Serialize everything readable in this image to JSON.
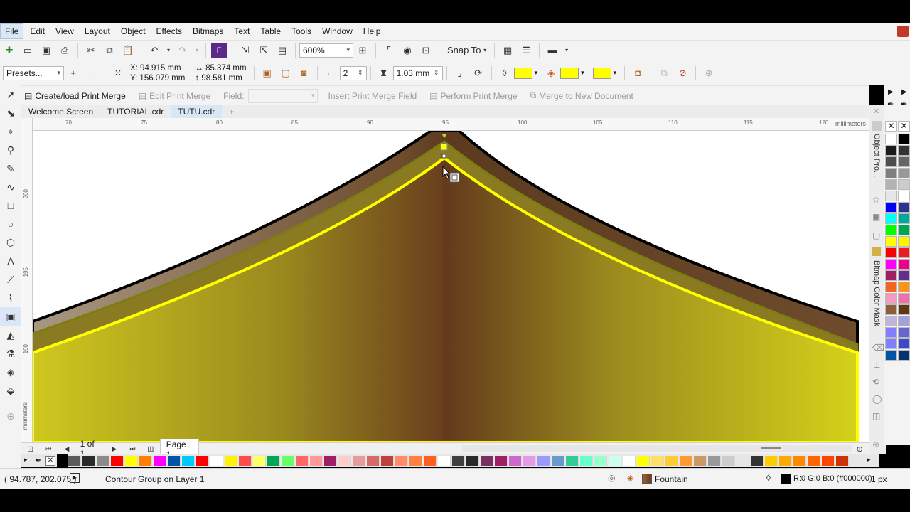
{
  "menu": [
    "File",
    "Edit",
    "View",
    "Layout",
    "Object",
    "Effects",
    "Bitmaps",
    "Text",
    "Table",
    "Tools",
    "Window",
    "Help"
  ],
  "toolbar1": {
    "zoom": "600%",
    "snap_to": "Snap To"
  },
  "propbar": {
    "presets": "Presets...",
    "x": "X: 94.915 mm",
    "y": "Y: 156.079 mm",
    "w": "85.374 mm",
    "h": "98.581 mm",
    "steps": "2",
    "offset": "1.03 mm",
    "colors": {
      "outline": "#ffff00",
      "fill": "#ffff00",
      "accel": "#ffff00"
    }
  },
  "printmerge": {
    "create": "Create/load Print Merge",
    "edit": "Edit Print Merge",
    "field": "Field:",
    "insert": "Insert Print Merge Field",
    "perform": "Perform Print Merge",
    "merge_new": "Merge to New Document"
  },
  "tabs": [
    "Welcome Screen",
    "TUTORIAL.cdr",
    "TUTU.cdr"
  ],
  "ruler": {
    "unit": "millimeters",
    "h_ticks": [
      "70",
      "75",
      "80",
      "85",
      "90",
      "95",
      "100",
      "105",
      "110",
      "115",
      "120"
    ],
    "v_ticks": [
      "200",
      "195",
      "190"
    ]
  },
  "dockers": [
    "Object Pro...",
    "Bitmap Color Mask"
  ],
  "nav": {
    "page_count": "1 of 1",
    "page_tab": "Page 1"
  },
  "status": {
    "coords": "( 94.787, 202.075 )",
    "selection": "Contour Group on Layer 1",
    "fill": "Fountain",
    "outline": "R:0 G:0 B:0 (#000000)",
    "outline_width": "1 px"
  },
  "palette_colors": [
    "#ffffff",
    "#000000",
    "#1a1a1a",
    "#333333",
    "#4d4d4d",
    "#666666",
    "#808080",
    "#999999",
    "#b3b3b3",
    "#cccccc",
    "#e6e6e6",
    "#ffffff",
    "#0000ff",
    "#2e3192",
    "#00ffff",
    "#00a99d",
    "#00ff00",
    "#00a651",
    "#ffff00",
    "#fff200",
    "#ff0000",
    "#ed1c24",
    "#ff00ff",
    "#ec008c",
    "#9e1f63",
    "#662d91",
    "#f26522",
    "#f7941d",
    "#f49ac1",
    "#f06eaa",
    "#8b5e3c",
    "#603913",
    "#c2b5d9",
    "#a3a3d9",
    "#7f7fff",
    "#6666cc",
    "#8080ff",
    "#3f48cc",
    "#0054a6",
    "#003471"
  ],
  "hpalette_colors": [
    "#5b5b5b",
    "#2a2a2a",
    "#8a8a8a",
    "#ff0000",
    "#ffff00",
    "#ff8000",
    "#ff00ff",
    "#0054a6",
    "#00c8ff",
    "#ff0000",
    "#ffffff",
    "#fff200",
    "#ff4d4d",
    "#ffff66",
    "#00a651",
    "#66ff66",
    "#ff6666",
    "#ff9999",
    "#9e1f63",
    "#ffcccc",
    "#e89b9b",
    "#d46a6a",
    "#c04040",
    "#ff8c66",
    "#ff8040",
    "#ff6020",
    "#ffffff",
    "#404040",
    "#2a2a2a",
    "#7a3060",
    "#9e1f63",
    "#cc66cc",
    "#e699e6",
    "#9999ff",
    "#6699cc",
    "#33cc99",
    "#66ffcc",
    "#99ffcc",
    "#ccffee",
    "#ffffff",
    "#ffff00",
    "#ffe066",
    "#ffcc33",
    "#ff9933",
    "#cc9966",
    "#999999",
    "#cccccc",
    "#e6e6e6",
    "#333333",
    "#ffcc00",
    "#ffaa00",
    "#ff8800",
    "#ff6600",
    "#ff4400",
    "#cc3300"
  ]
}
